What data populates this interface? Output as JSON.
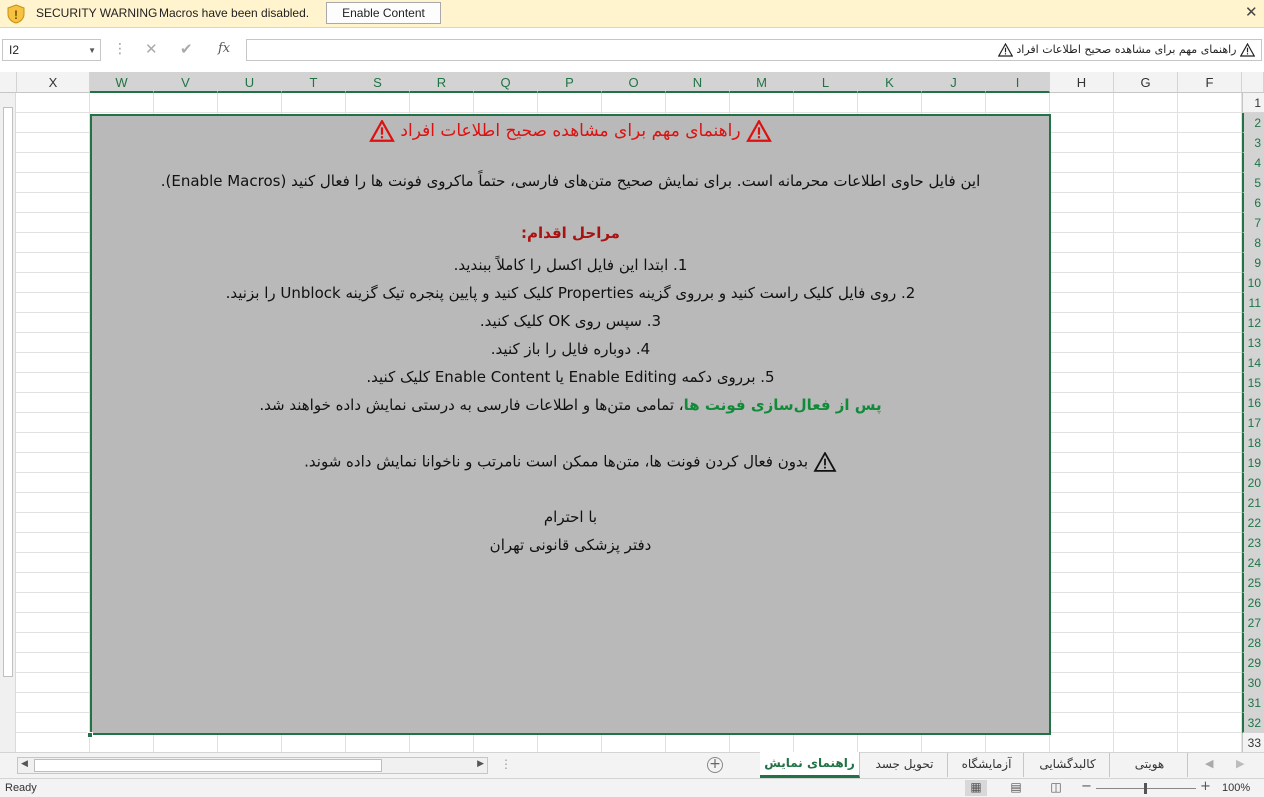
{
  "security_bar": {
    "title": "SECURITY WARNING",
    "message": "Macros have been disabled.",
    "button": "Enable Content",
    "close": "✕"
  },
  "formula_bar": {
    "name_box": "I2",
    "cancel": "✕",
    "enter": "✔",
    "fx": "fx",
    "formula_text": "راهنمای مهم برای مشاهده صحیح اطلاعات افراد"
  },
  "columns": [
    "X",
    "W",
    "V",
    "U",
    "T",
    "S",
    "R",
    "Q",
    "P",
    "O",
    "N",
    "M",
    "L",
    "K",
    "J",
    "I",
    "H",
    "G",
    "F"
  ],
  "selected_columns": [
    "W",
    "V",
    "U",
    "T",
    "S",
    "R",
    "Q",
    "P",
    "O",
    "N",
    "M",
    "L",
    "K",
    "J",
    "I"
  ],
  "rows": [
    "1",
    "2",
    "3",
    "4",
    "5",
    "6",
    "7",
    "8",
    "9",
    "10",
    "11",
    "12",
    "13",
    "14",
    "15",
    "16",
    "17",
    "18",
    "19",
    "20",
    "21",
    "22",
    "23",
    "24",
    "25",
    "26",
    "27",
    "28",
    "29",
    "30",
    "31",
    "32",
    "33"
  ],
  "cell_content": {
    "title": "راهنمای مهم برای مشاهده صحیح اطلاعات افراد",
    "intro": "این فایل حاوی اطلاعات محرمانه است. برای نمایش صحیح متن‌های فارسی، حتماً ماکروی فونت ها را فعال کنید (Enable Macros).",
    "steps_heading": "مراحل اقدام:",
    "step1": "1. ابتدا این فایل اکسل را کاملاً ببندید.",
    "step2": "2. روی فایل کلیک راست کنید و برروی گزینه  Properties  کلیک کنید و پایین پنجره تیک گزینه Unblock را بزنید.",
    "step3": "3. سپس روی OK کلیک کنید.",
    "step4": "4. دوباره فایل را باز کنید.",
    "step5": "5. برروی دکمه Enable Editing یا Enable Content کلیک کنید.",
    "after_green": "پس از فعال‌سازی فونت ها",
    "after_rest": "، تمامی متن‌ها و اطلاعات فارسی به درستی نمایش داده خواهند شد.",
    "warning": "بدون فعال کردن فونت ها، متن‌ها ممکن است نامرتب و ناخوانا نمایش داده شوند.",
    "regards": "با احترام",
    "signature": "دفتر پزشکی قانونی تهران"
  },
  "sheet_tabs": [
    "راهنمای نمایش",
    "تحویل جسد",
    "آزمایشگاه",
    "کالبدگشایی",
    "هویتی"
  ],
  "active_tab": "راهنمای نمایش",
  "status_bar": {
    "ready": "Ready",
    "zoom": "100%",
    "zoom_fraction": 0.5
  },
  "colors": {
    "excel_green": "#217346",
    "security_bg": "#fff4ce",
    "merged_fill": "#b9b9b9",
    "title_red": "#d11111",
    "heading_red": "#aa1111",
    "accent_green": "#118b3a"
  }
}
